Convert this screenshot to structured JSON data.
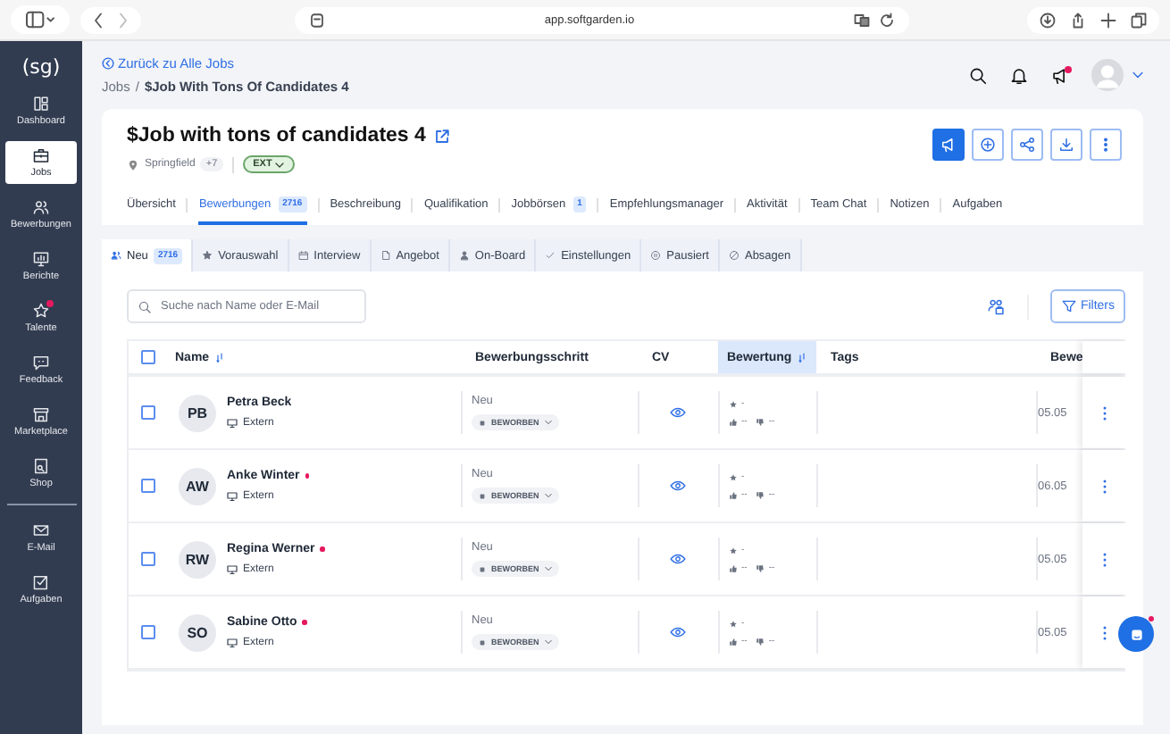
{
  "browser": {
    "url": "app.softgarden.io"
  },
  "sidebar": {
    "logo": "(sg)",
    "items": [
      {
        "label": "Dashboard",
        "selected": false,
        "badge": false
      },
      {
        "label": "Jobs",
        "selected": true,
        "badge": false
      },
      {
        "label": "Bewerbungen",
        "selected": false,
        "badge": false
      },
      {
        "label": "Berichte",
        "selected": false,
        "badge": false
      },
      {
        "label": "Talente",
        "selected": false,
        "badge": true
      },
      {
        "label": "Feedback",
        "selected": false,
        "badge": false
      },
      {
        "label": "Marketplace",
        "selected": false,
        "badge": false
      },
      {
        "label": "Shop",
        "selected": false,
        "badge": false
      }
    ],
    "bottom_items": [
      {
        "label": "E-Mail",
        "selected": false,
        "badge": false
      },
      {
        "label": "Aufgaben",
        "selected": false,
        "badge": false
      }
    ]
  },
  "header": {
    "back_link": "Zurück zu Alle Jobs",
    "breadcrumb": {
      "parent": "Jobs",
      "separator": "/",
      "current": "$Job With Tons Of Candidates 4"
    },
    "announcements_badge": true
  },
  "job": {
    "title": "$Job with tons of candidates 4",
    "location": "Springfield",
    "more_locations": "+7",
    "tag": "EXT"
  },
  "tabs": [
    {
      "label": "Übersicht",
      "selected": false
    },
    {
      "label": "Bewerbungen",
      "count": "2716",
      "selected": true
    },
    {
      "label": "Beschreibung",
      "selected": false
    },
    {
      "label": "Qualifikation",
      "selected": false
    },
    {
      "label": "Jobbörsen",
      "count": "1",
      "selected": false
    },
    {
      "label": "Empfehlungsmanager",
      "selected": false
    },
    {
      "label": "Aktivität",
      "selected": false
    },
    {
      "label": "Team Chat",
      "selected": false
    },
    {
      "label": "Notizen",
      "selected": false
    },
    {
      "label": "Aufgaben",
      "selected": false
    }
  ],
  "stage_tabs": [
    {
      "label": "Neu",
      "count": "2716",
      "selected": true
    },
    {
      "label": "Vorauswahl",
      "selected": false
    },
    {
      "label": "Interview",
      "selected": false
    },
    {
      "label": "Angebot",
      "selected": false
    },
    {
      "label": "On-Board",
      "selected": false
    },
    {
      "label": "Einstellungen",
      "selected": false
    },
    {
      "label": "Pausiert",
      "selected": false
    },
    {
      "label": "Absagen",
      "selected": false
    }
  ],
  "search": {
    "placeholder": "Suche nach Name oder E-Mail"
  },
  "filters_button": "Filters",
  "table": {
    "select_all_checked": false,
    "columns": [
      {
        "label": "Name",
        "sortable": true,
        "highlighted": false
      },
      {
        "label": "Bewerbungsschritt",
        "highlighted": false
      },
      {
        "label": "CV",
        "highlighted": false
      },
      {
        "label": "Bewertung",
        "sortable": true,
        "highlighted": true
      },
      {
        "label": "Tags",
        "highlighted": false
      },
      {
        "label": "Bewe",
        "highlighted": false
      }
    ],
    "rows": [
      {
        "checked": false,
        "initials": "PB",
        "name": "Petra Beck",
        "unread": false,
        "source": "Extern",
        "step": "Neu",
        "stage": "BEWORBEN",
        "rating": "-",
        "likes": "--",
        "dislikes": "--",
        "date": "05.05"
      },
      {
        "checked": false,
        "initials": "AW",
        "name": "Anke Winter",
        "unread": true,
        "source": "Extern",
        "step": "Neu",
        "stage": "BEWORBEN",
        "rating": "-",
        "likes": "--",
        "dislikes": "--",
        "date": "06.05"
      },
      {
        "checked": false,
        "initials": "RW",
        "name": "Regina Werner",
        "unread": true,
        "source": "Extern",
        "step": "Neu",
        "stage": "BEWORBEN",
        "rating": "-",
        "likes": "--",
        "dislikes": "--",
        "date": "05.05"
      },
      {
        "checked": false,
        "initials": "SO",
        "name": "Sabine Otto",
        "unread": true,
        "source": "Extern",
        "step": "Neu",
        "stage": "BEWORBEN",
        "rating": "-",
        "likes": "--",
        "dislikes": "--",
        "date": "05.05"
      }
    ]
  },
  "chat": {
    "badge": true
  }
}
